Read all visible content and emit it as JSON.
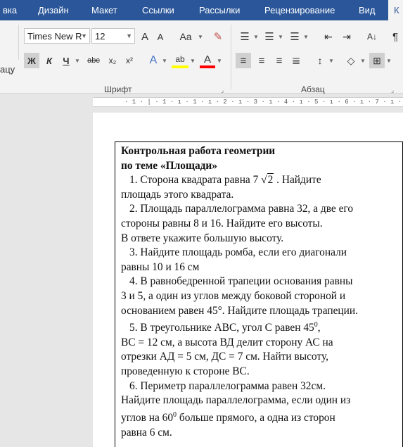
{
  "tabs": [
    "вка",
    "Дизайн",
    "Макет",
    "Ссылки",
    "Рассылки",
    "Рецензирование",
    "Вид",
    "К"
  ],
  "ribbon": {
    "left_cut_label": "ацу",
    "font_name": "Times New R",
    "font_size": "12",
    "grow_font": "A",
    "shrink_font": "A",
    "change_case": "Aa",
    "bold": "Ж",
    "italic": "К",
    "underline": "Ч",
    "strikethrough": "abc",
    "subscript": "x₂",
    "superscript": "x²",
    "text_effects": "A",
    "highlight": "ab",
    "font_color": "A",
    "sort": "А↓",
    "show_marks": "¶",
    "group_font": "Шрифт",
    "group_paragraph": "Абзац"
  },
  "ruler_text": "· 1 · | · 1 · ı · 1 · ı · 2 · ı · 3 · ı · 4 · ı · 5 · ı · 6 · ı · 7 · ı · 8 · ı · 9 ·",
  "colors": {
    "ribbon_blue": "#2b579a",
    "highlight_yellow": "#ffff00",
    "font_red": "#ff0000"
  },
  "document": {
    "title1": "Контрольная работа геометрии",
    "title2": "по теме «Площади»",
    "p1_a": "1.  Сторона квадрата равна 7 ",
    "p1_sqrt_sign": "√",
    "p1_sqrt_val": "2",
    "p1_b": " . Найдите",
    "p1_line2": "площадь этого квадрата.",
    "p2_line1": "2.  Площадь параллелограмма равна 32, а две его",
    "p2_line2": "стороны равны 8 и 16. Найдите его высоты.",
    "p2_line3": "В ответе укажите большую высоту.",
    "p3_line1": "3.  Найдите площадь ромба, если его диагонали",
    "p3_line2": "равны 10 и 16 см",
    "p4_line1": "4.  В равнобедренной трапеции основания равны",
    "p4_line2": "3 и 5, а один из углов между боковой стороной и",
    "p4_line3": "основанием равен 45°. Найдите площадь трапеции.",
    "p5_line1_a": "5.  В треугольнике АВС, угол С равен 45",
    "p5_line1_sup": "0",
    "p5_line1_b": ",",
    "p5_line2": "ВС = 12 см, а высота ВД делит сторону АС на",
    "p5_line3": "отрезки АД = 5 см, ДС = 7 см. Найти высоту,",
    "p5_line4": "проведенную к стороне ВС.",
    "p6_line1": "6.  Периметр параллелограмма равен 32см.",
    "p6_line2": "Найдите площадь параллелограмма, если один из",
    "p6_line3_a": "углов на 60",
    "p6_line3_sup": "0",
    "p6_line3_b": " больше прямого, а одна из сторон",
    "p6_line4": "равна 6 см."
  }
}
